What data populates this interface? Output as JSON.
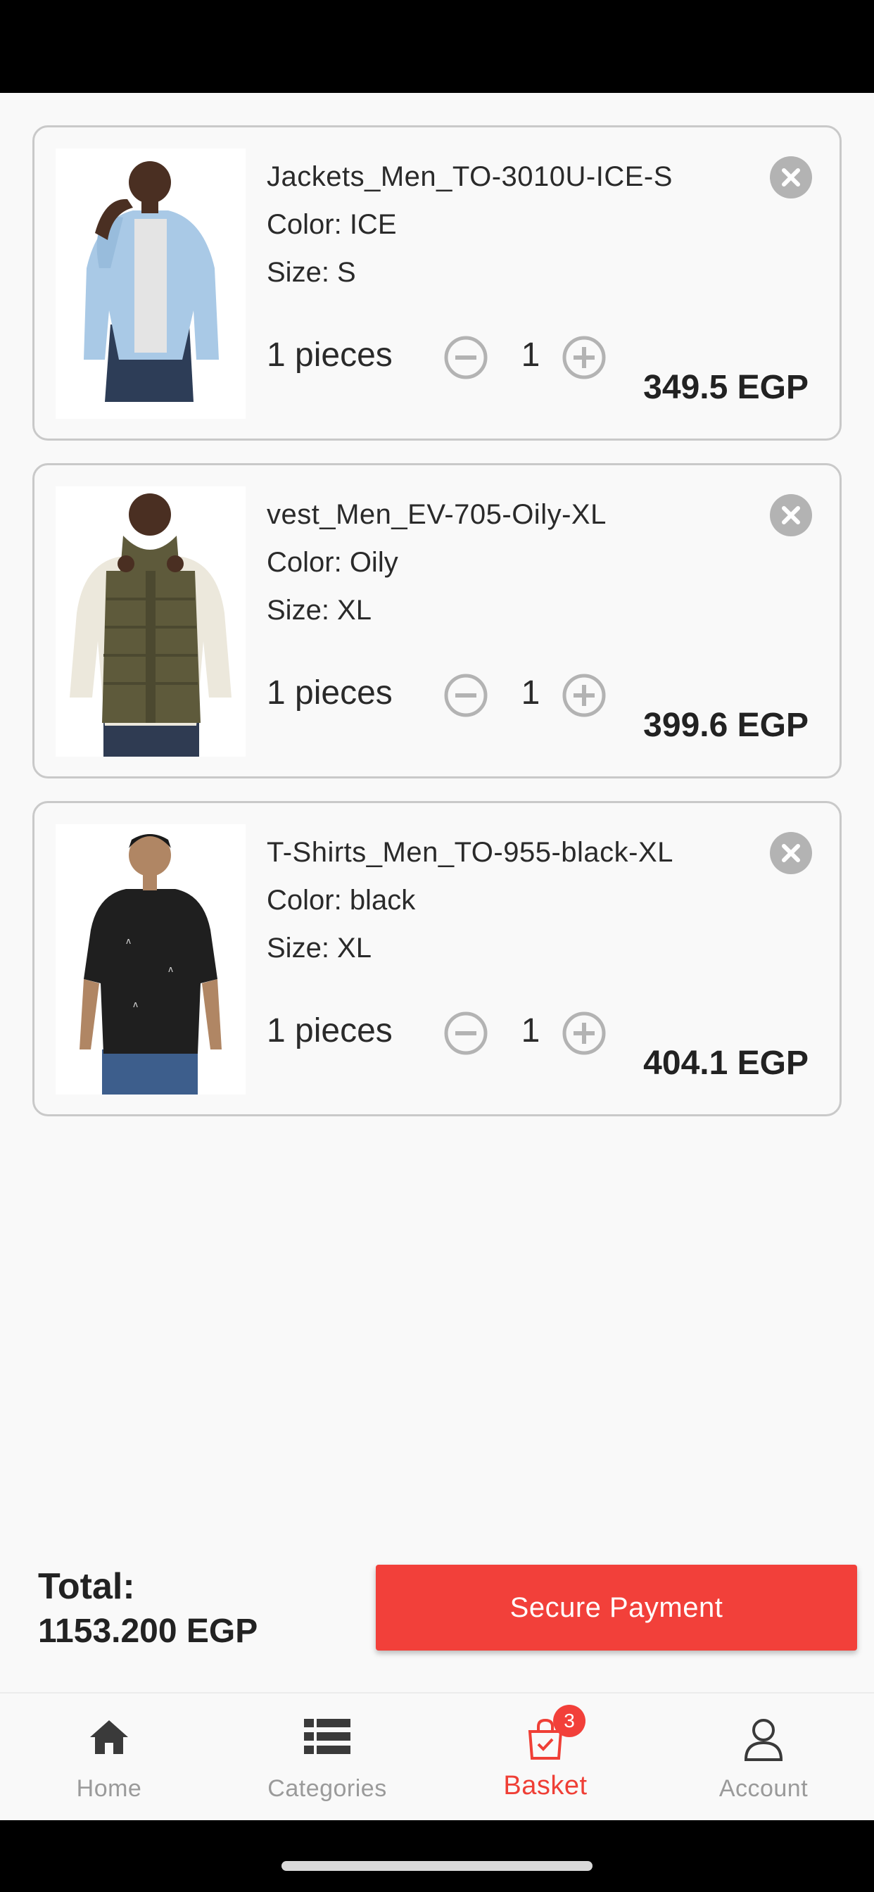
{
  "cart": {
    "items": [
      {
        "name": "Jackets_Men_TO-3010U-ICE-S",
        "color": "Color: ICE",
        "size": "Size: S",
        "pieces": "1 pieces",
        "quantity": "1",
        "price": "349.5 EGP"
      },
      {
        "name": "vest_Men_EV-705-Oily-XL",
        "color": "Color: Oily",
        "size": "Size: XL",
        "pieces": "1 pieces",
        "quantity": "1",
        "price": "399.6 EGP"
      },
      {
        "name": "T-Shirts_Men_TO-955-black-XL",
        "color": "Color: black",
        "size": "Size: XL",
        "pieces": "1 pieces",
        "quantity": "1",
        "price": "404.1 EGP"
      }
    ]
  },
  "summary": {
    "total_label": "Total:",
    "total_value": "1153.200 EGP",
    "pay_label": "Secure Payment"
  },
  "tabbar": {
    "home": "Home",
    "categories": "Categories",
    "basket": "Basket",
    "basket_count": "3",
    "account": "Account"
  },
  "icons": {
    "remove": "close-circle-icon",
    "decrement": "minus-circle-icon",
    "increment": "plus-circle-icon",
    "home": "home-icon",
    "categories": "list-icon",
    "basket": "shopping-bag-icon",
    "account": "user-icon"
  },
  "colors": {
    "accent": "#f2403a",
    "background": "#f9f9f9",
    "card_border": "#c9c9c9",
    "icon_gray": "#b3b3b3"
  }
}
